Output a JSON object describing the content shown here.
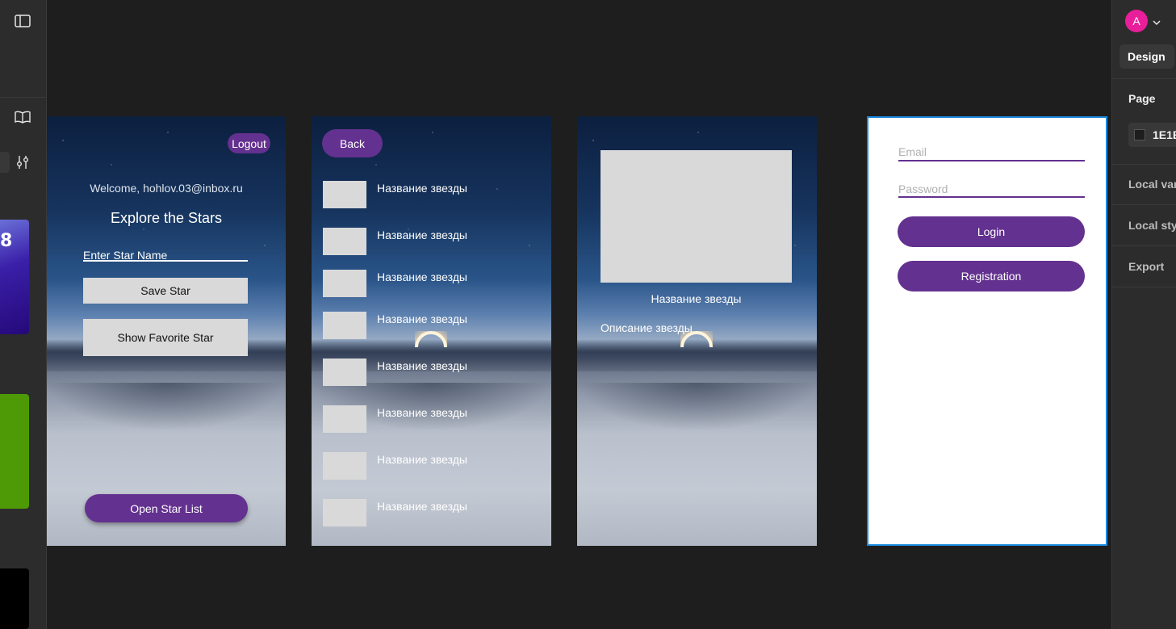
{
  "left_rail": {
    "icons": [
      "sidebar-toggle-icon",
      "book-icon",
      "sliders-icon"
    ],
    "thumbnail_number": "8"
  },
  "frame1": {
    "logout": "Logout",
    "welcome": "Welcome, hohlov.03@inbox.ru",
    "title": "Explore the Stars",
    "input_placeholder": "Enter Star Name",
    "save_button": "Save Star",
    "favorite_button": "Show Favorite Star",
    "open_list_button": "Open Star List"
  },
  "frame2": {
    "back": "Back",
    "items": [
      "Название звезды",
      "Название звезды",
      "Название звезды",
      "Название звезды",
      "Название звезды",
      "Название звезды",
      "Название звезды",
      "Название звезды"
    ]
  },
  "frame3": {
    "star_name": "Название звезды",
    "star_description": "Описание звезды"
  },
  "frame4": {
    "email_placeholder": "Email",
    "password_placeholder": "Password",
    "login_button": "Login",
    "registration_button": "Registration"
  },
  "right_panel": {
    "avatar_letter": "A",
    "tab": "Design",
    "page_label": "Page",
    "page_color": "1E1E",
    "local_variables": "Local var",
    "local_styles": "Local sty",
    "export": "Export"
  },
  "colors": {
    "canvas": "#1e1e1e",
    "accent_purple": "#63318f",
    "selection": "#1a8be0",
    "avatar": "#e91e9a"
  }
}
